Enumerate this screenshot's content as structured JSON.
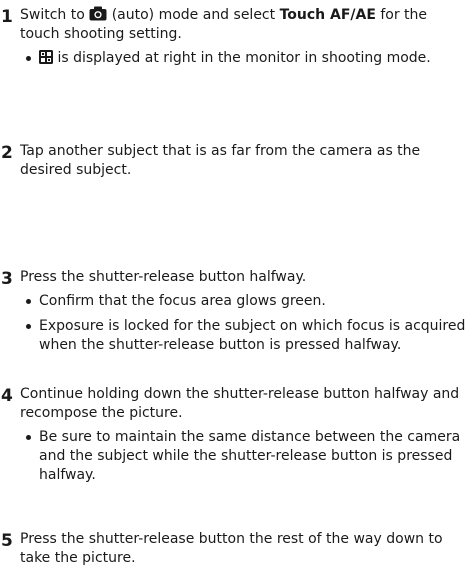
{
  "steps": [
    {
      "num": "1",
      "before_icon": "Switch to ",
      "icon": "camera-icon",
      "after_icon": " (auto) mode and select ",
      "bold": "Touch AF/AE",
      "after_bold": " for the touch shooting setting.",
      "bullets": [
        {
          "icon": "touch-af-ae-icon",
          "text": " is displayed at right in the monitor in shooting mode."
        }
      ]
    },
    {
      "num": "2",
      "text": "Tap another subject that is as far from the camera as the desired subject."
    },
    {
      "num": "3",
      "text": "Press the shutter-release button halfway.",
      "bullets": [
        {
          "text": "Confirm that the focus area glows green."
        },
        {
          "text": "Exposure is locked for the subject on which focus is acquired when the shutter-release button is pressed halfway."
        }
      ]
    },
    {
      "num": "4",
      "text": "Continue holding down the shutter-release button halfway and recompose the picture.",
      "bullets": [
        {
          "text": "Be sure to maintain the same distance between the camera and the subject while the shutter-release button is pressed halfway."
        }
      ]
    },
    {
      "num": "5",
      "text": "Press the shutter-release button the rest of the way down to take the picture."
    }
  ]
}
